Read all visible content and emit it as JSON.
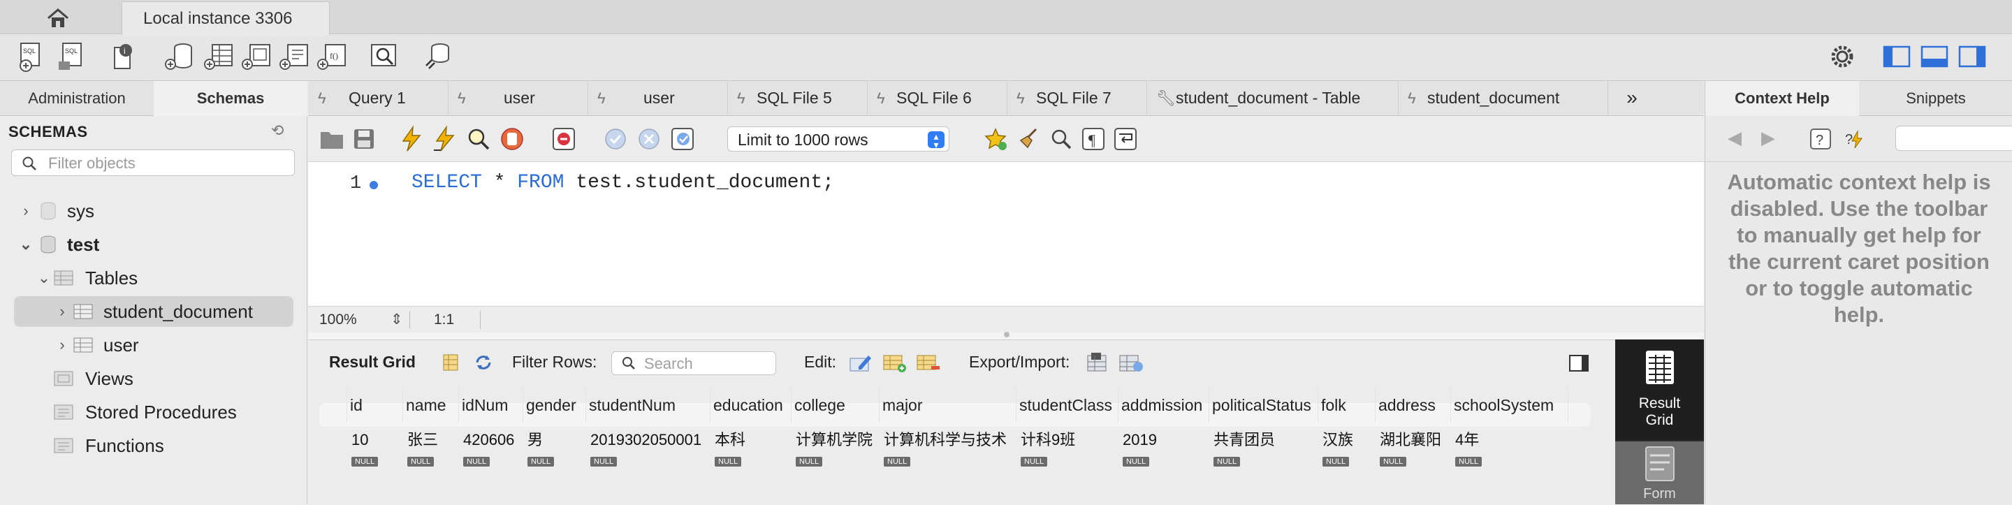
{
  "window": {
    "instance_tab": "Local instance 3306"
  },
  "left_tabs": {
    "administration": "Administration",
    "schemas": "Schemas"
  },
  "query_tabs": [
    "Query 1",
    "user",
    "user",
    "SQL File 5",
    "SQL File 6",
    "SQL File 7",
    "student_document - Table",
    "student_document"
  ],
  "right_tabs": {
    "context_help": "Context Help",
    "snippets": "Snippets"
  },
  "sidebar": {
    "title": "SCHEMAS",
    "filter_placeholder": "Filter objects",
    "tree": {
      "sys": "sys",
      "test": "test",
      "tables": "Tables",
      "table1": "student_document",
      "table2": "user",
      "views": "Views",
      "procedures": "Stored Procedures",
      "functions": "Functions"
    }
  },
  "editor": {
    "limit": "Limit to 1000 rows",
    "line_number": "1",
    "code": {
      "kw1": "SELECT",
      "mid": " * ",
      "kw2": "FROM",
      "rest": " test.student_document;"
    },
    "zoom": "100%",
    "position": "1:1"
  },
  "results": {
    "label": "Result Grid",
    "filter_label": "Filter Rows:",
    "search_placeholder": "Search",
    "edit_label": "Edit:",
    "export_label": "Export/Import:",
    "columns": [
      "id",
      "name",
      "idNum",
      "gender",
      "studentNum",
      "education",
      "college",
      "major",
      "studentClass",
      "addmission",
      "politicalStatus",
      "folk",
      "address",
      "schoolSystem"
    ],
    "row": [
      "10",
      "张三",
      "420606",
      "男",
      "2019302050001",
      "本科",
      "计算机学院",
      "计算机科学与技术",
      "计科9班",
      "2019",
      "共青团员",
      "汉族",
      "湖北襄阳",
      "4年"
    ],
    "null_label": "NULL",
    "side": {
      "grid_line1": "Result",
      "grid_line2": "Grid",
      "form": "Form"
    }
  },
  "context_help": {
    "text": "Automatic context help is disabled. Use the toolbar to manually get help for the current caret position or to toggle automatic help."
  }
}
